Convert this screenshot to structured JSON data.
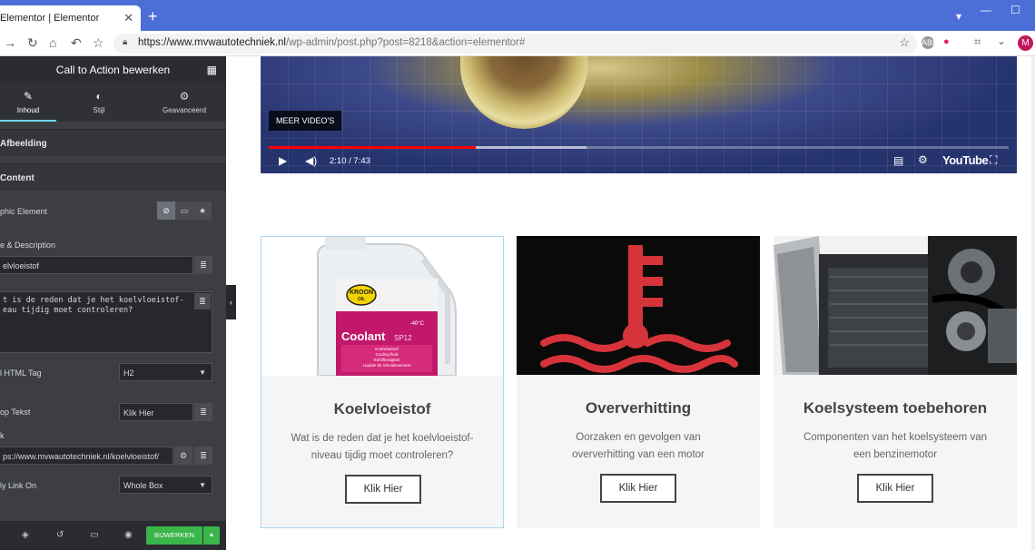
{
  "browser": {
    "tab_title": "Elementor | Elementor",
    "tab_close": "✕",
    "new_tab": "+",
    "url_host": "https://www.mvwautotechniek.nl",
    "url_path": "/wp-admin/post.php?post=8218&action=elementor#",
    "profile_initial": "M",
    "extension_abp": "ABP"
  },
  "panel": {
    "header_title": "Call to Action bewerken",
    "tabs": [
      {
        "label": "Inhoud"
      },
      {
        "label": "Stijl"
      },
      {
        "label": "Geavanceerd"
      }
    ],
    "sections": {
      "image": "Afbeelding",
      "content": "Content"
    },
    "controls": {
      "graphic_element_label": "phic Element",
      "title_desc_label": "e & Description",
      "title_value": "elvloeistof",
      "description_value": "t is de reden dat je het koelvloeistof-\neau tijdig moet controleren?",
      "html_tag_label": "l HTML Tag",
      "html_tag_value": "H2",
      "button_text_label": "op Tekst",
      "button_text_value": "Klik Hier",
      "link_label": "k",
      "link_value": "ps://www.mvwautotechniek.nl/koelvloeistof/",
      "apply_link_label": "ly Link On",
      "apply_link_value": "Whole Box"
    },
    "footer": {
      "update_label": "BIJWERKEN"
    }
  },
  "video": {
    "more_videos": "MEER VIDEO'S",
    "time": "2:10 / 7:43",
    "brand": "YouTube",
    "progress_played": 0.28,
    "progress_buffered": 0.43
  },
  "cards": [
    {
      "title": "Koelvloeistof",
      "desc_line1": "Wat is de reden dat je het koelvloeistof-",
      "desc_line2": "niveau tijdig moet controleren?",
      "button": "Klik Hier",
      "bottle_brand_top": "KROON",
      "bottle_brand_bottom": "OIL",
      "bottle_product": "Coolant",
      "bottle_variant": "SP12",
      "bottle_temp": "-40°C",
      "bottle_line1": "Koelvloeistof",
      "bottle_line2": "Cooling fluid",
      "bottle_line3": "Kühlflüssigkeit",
      "bottle_line4": "Liquide de refroidissement"
    },
    {
      "title": "Oververhitting",
      "desc_line1": "Oorzaken en gevolgen van",
      "desc_line2": "oververhitting van een motor",
      "button": "Klik Hier"
    },
    {
      "title": "Koelsysteem toebehoren",
      "desc_line1": "Componenten van het koelsysteem van",
      "desc_line2": "een benzinemotor",
      "button": "Klik Hier"
    }
  ],
  "colors": {
    "chrome_blue": "#4b6fd6",
    "panel_dark": "#3c3e44",
    "update_green": "#39b54a",
    "warning_red": "#d6343a"
  }
}
